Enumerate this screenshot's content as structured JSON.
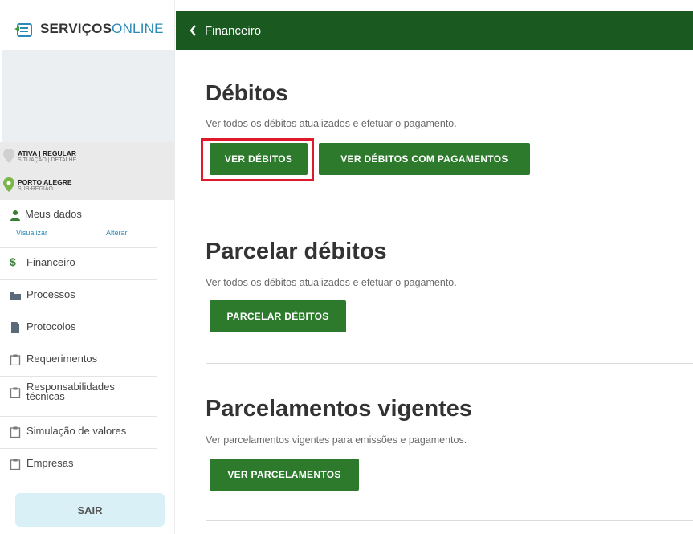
{
  "logo": {
    "part1": "SERVIÇOS",
    "part2": "ONLINE"
  },
  "status": {
    "line1_main": "ATIVA | REGULAR",
    "line1_sub": "SITUAÇÃO | DETALHE",
    "line2_main": "PORTO ALEGRE",
    "line2_sub": "SUB-REGIÃO"
  },
  "sidebar": {
    "meus_dados": "Meus dados",
    "visualizar": "Visualizar",
    "alterar": "Alterar",
    "items": [
      {
        "label": "Financeiro",
        "icon": "dollar-icon"
      },
      {
        "label": "Processos",
        "icon": "folder-icon"
      },
      {
        "label": "Protocolos",
        "icon": "document-icon"
      },
      {
        "label": "Requerimentos",
        "icon": "clipboard-icon"
      },
      {
        "label": "Responsabilidades técnicas",
        "icon": "clipboard-icon"
      },
      {
        "label": "Simulação de valores",
        "icon": "clipboard-icon"
      },
      {
        "label": "Empresas",
        "icon": "clipboard-icon"
      }
    ],
    "sair": "SAIR"
  },
  "topbar": {
    "title": "Financeiro"
  },
  "sections": {
    "debitos": {
      "title": "Débitos",
      "desc": "Ver todos os débitos atualizados e efetuar o pagamento.",
      "btn1": "VER DÉBITOS",
      "btn2": "VER DÉBITOS COM PAGAMENTOS"
    },
    "parcelar": {
      "title": "Parcelar débitos",
      "desc": "Ver todos os débitos atualizados e efetuar o pagamento.",
      "btn": "PARCELAR DÉBITOS"
    },
    "parcelamentos": {
      "title": "Parcelamentos vigentes",
      "desc": "Ver parcelamentos vigentes para emissões e pagamentos.",
      "btn": "VER PARCELAMENTOS"
    }
  },
  "colors": {
    "primary": "#2d7a2d",
    "topbar": "#1a5a20",
    "highlight": "#e0182b",
    "link": "#2b8ab8"
  }
}
